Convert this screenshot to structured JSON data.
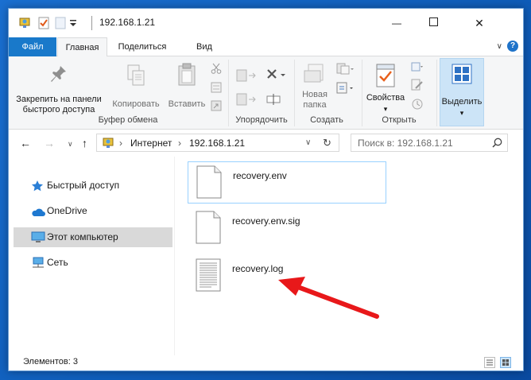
{
  "window": {
    "title": "192.168.1.21",
    "minimize_symbol": "—",
    "maximize_symbol": "☐",
    "close_symbol": "✕"
  },
  "tabs": {
    "file": "Файл",
    "home": "Главная",
    "share": "Поделиться",
    "view": "Вид"
  },
  "ribbon": {
    "pin_label": "Закрепить на панели быстрого доступа",
    "pin_line1": "Закрепить на панели",
    "pin_line2": "быстрого доступа",
    "copy_label": "Копировать",
    "paste_label": "Вставить",
    "clipboard_group": "Буфер обмена",
    "organize_group": "Упорядочить",
    "new_folder_line1": "Новая",
    "new_folder_line2": "папка",
    "create_group": "Создать",
    "properties_label": "Свойства",
    "open_group": "Открыть",
    "select_label": "Выделить"
  },
  "address": {
    "crumb1": "Интернет",
    "crumb2": "192.168.1.21",
    "search_placeholder": "Поиск в: 192.168.1.21"
  },
  "nav_pane": {
    "items": [
      {
        "label": "Быстрый доступ",
        "icon": "star-icon"
      },
      {
        "label": "OneDrive",
        "icon": "cloud-icon"
      },
      {
        "label": "Этот компьютер",
        "icon": "computer-icon"
      },
      {
        "label": "Сеть",
        "icon": "network-icon"
      }
    ]
  },
  "files": [
    {
      "name": "recovery.env",
      "icon": "blank-file-icon"
    },
    {
      "name": "recovery.env.sig",
      "icon": "blank-file-icon"
    },
    {
      "name": "recovery.log",
      "icon": "text-file-icon"
    }
  ],
  "status": {
    "items_count": "Элементов: 3"
  },
  "colors": {
    "accent": "#1979ca",
    "selection": "#cce4f7",
    "arrow": "#e8181a"
  }
}
